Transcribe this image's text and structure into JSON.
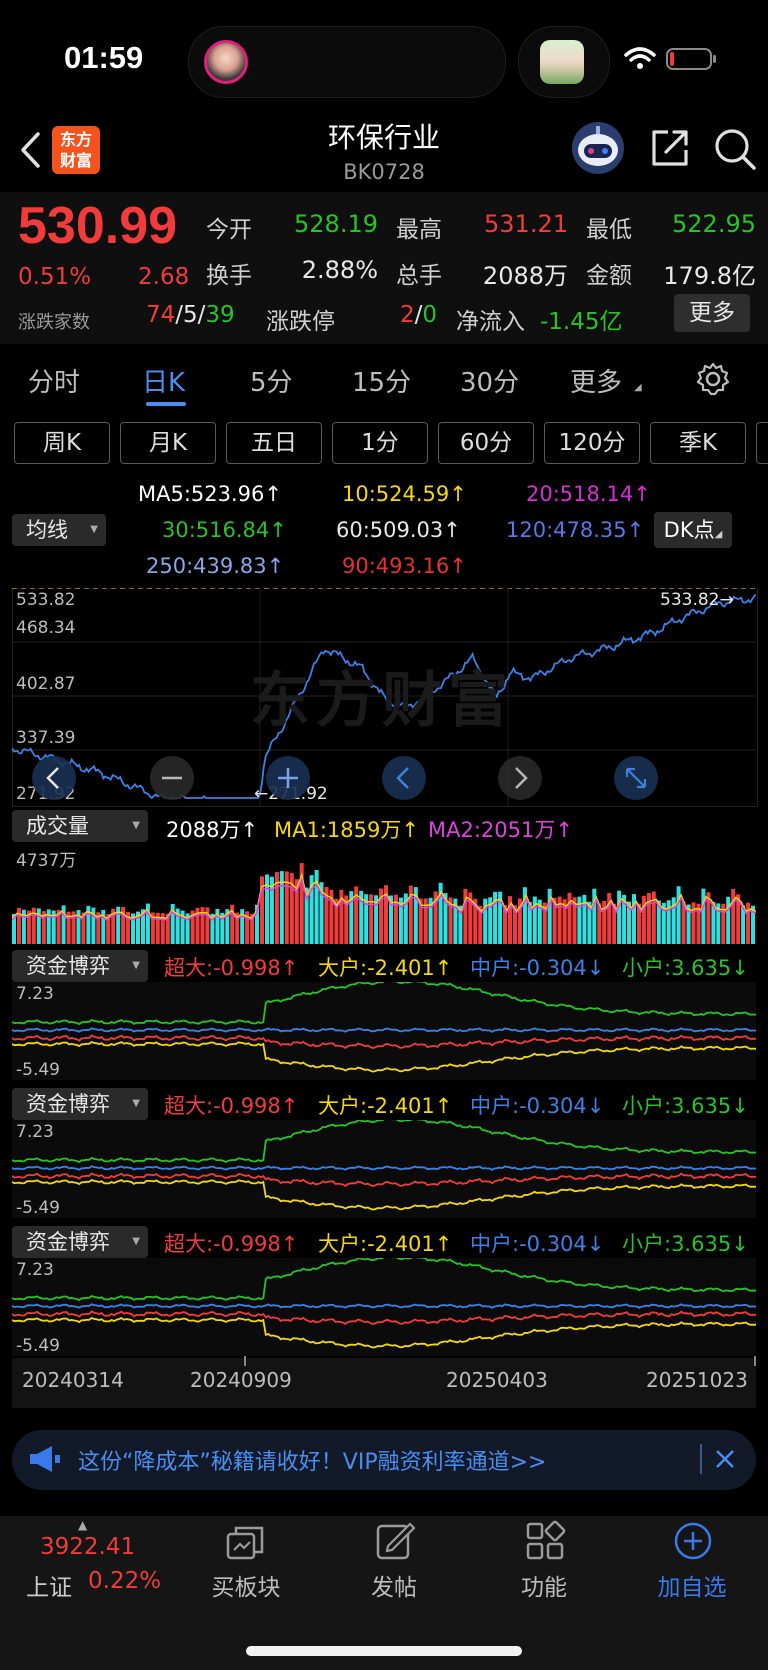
{
  "status_bar": {
    "time": "01:59"
  },
  "header": {
    "title": "环保行业",
    "code": "BK0728",
    "logo_text": "东方\n财富",
    "icons": [
      "back-chevron-icon",
      "robot-assistant-icon",
      "share-icon",
      "search-icon"
    ]
  },
  "quote": {
    "price": "530.99",
    "change_pct": "0.51%",
    "change": "2.68",
    "open_label": "今开",
    "open": "528.19",
    "high_label": "最高",
    "high": "531.21",
    "low_label": "最低",
    "low": "522.95",
    "turnover_label": "换手",
    "turnover": "2.88%",
    "volume_label": "总手",
    "volume": "2088万",
    "amount_label": "金额",
    "amount": "179.8亿",
    "breadth_label": "涨跌家数",
    "up_count": "74",
    "flat_count": "5",
    "down_count": "39",
    "limit_label": "涨跌停",
    "limit_up": "2",
    "limit_down": "0",
    "netflow_label": "净流入",
    "netflow": "-1.45亿",
    "more_button": "更多",
    "colors": {
      "up": "#f23b3b",
      "down": "#27c427"
    }
  },
  "tabs": {
    "items": [
      "分时",
      "日K",
      "5分",
      "15分",
      "30分",
      "更多"
    ],
    "active": "日K"
  },
  "period_buttons": [
    "周K",
    "月K",
    "五日",
    "1分",
    "60分",
    "120分",
    "季K"
  ],
  "ma": {
    "selector_label": "均线",
    "dk_label": "DK点",
    "items": [
      {
        "label": "MA5:523.96↑",
        "color": "#ffffff"
      },
      {
        "label": "10:524.59↑",
        "color": "#f5d90a"
      },
      {
        "label": "20:518.14↑",
        "color": "#d62dd6"
      },
      {
        "label": "30:516.84↑",
        "color": "#27c427"
      },
      {
        "label": "60:509.03↑",
        "color": "#e8e8e8"
      },
      {
        "label": "120:478.35↑",
        "color": "#5878e8"
      },
      {
        "label": "250:439.83↑",
        "color": "#8aa8e8"
      },
      {
        "label": "90:493.16↑",
        "color": "#e83030"
      }
    ]
  },
  "main_chart": {
    "y_labels": [
      "533.82",
      "468.34",
      "402.87",
      "337.39",
      "271.92"
    ],
    "max_label": "533.82→",
    "min_label": "←271.92",
    "watermark": "东方财富",
    "line_color": "#3b82e8"
  },
  "volume": {
    "selector_label": "成交量",
    "vol": "2088万↑",
    "ma1": "MA1:1859万↑",
    "ma2": "MA2:2051万↑",
    "y_label": "4737万"
  },
  "capital_panels": [
    {
      "selector_label": "资金博弈",
      "super": "超大:-0.998↑",
      "big": "大户:-2.401↑",
      "mid": "中户:-0.304↓",
      "small": "小户:3.635↓",
      "y_max": "7.23",
      "y_min": "-5.49"
    },
    {
      "selector_label": "资金博弈",
      "super": "超大:-0.998↑",
      "big": "大户:-2.401↑",
      "mid": "中户:-0.304↓",
      "small": "小户:3.635↓",
      "y_max": "7.23",
      "y_min": "-5.49"
    },
    {
      "selector_label": "资金博弈",
      "super": "超大:-0.998↑",
      "big": "大户:-2.401↑",
      "mid": "中户:-0.304↓",
      "small": "小户:3.635↓",
      "y_max": "7.23",
      "y_min": "-5.49"
    }
  ],
  "x_axis": [
    "20240314",
    "20240909",
    "20250403",
    "20251023"
  ],
  "banner": {
    "text": "这份“降成本”秘籍请收好！VIP融资利率通道>>"
  },
  "bottom_bar": {
    "index_value": "3922.41",
    "index_name": "上证",
    "index_change": "0.22%",
    "items": [
      {
        "label": "买板块",
        "icon": "buy-sector-icon"
      },
      {
        "label": "发帖",
        "icon": "post-edit-icon"
      },
      {
        "label": "功能",
        "icon": "apps-grid-icon"
      },
      {
        "label": "加自选",
        "icon": "add-watchlist-icon"
      }
    ]
  }
}
